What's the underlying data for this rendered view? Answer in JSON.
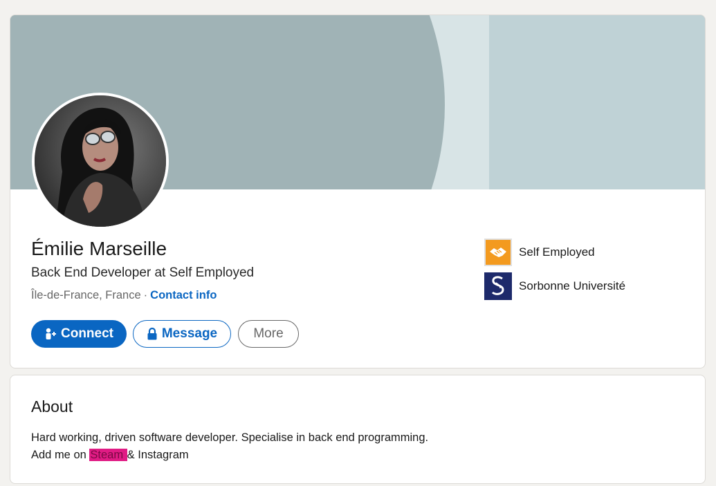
{
  "profile": {
    "name": "Émilie Marseille",
    "headline": "Back End Developer at Self Employed",
    "location": "Île-de-France, France",
    "separator": "·",
    "contact_info_label": "Contact info"
  },
  "actions": {
    "connect_label": "Connect",
    "message_label": "Message",
    "more_label": "More"
  },
  "organizations": [
    {
      "name": "Self Employed",
      "icon": "handshake-icon",
      "color": "#f39a1f"
    },
    {
      "name": "Sorbonne Université",
      "icon": "sorbonne-logo",
      "color": "#1d2a6b"
    }
  ],
  "about": {
    "title": "About",
    "line1": "Hard working, driven software developer. Specialise in back end programming.",
    "line2_prefix": "Add me on ",
    "line2_highlight": "Steam ",
    "line2_suffix": "& Instagram"
  },
  "colors": {
    "accent": "#0a66c2",
    "banner": "#a0b3b6",
    "highlight": "#e01b84"
  }
}
